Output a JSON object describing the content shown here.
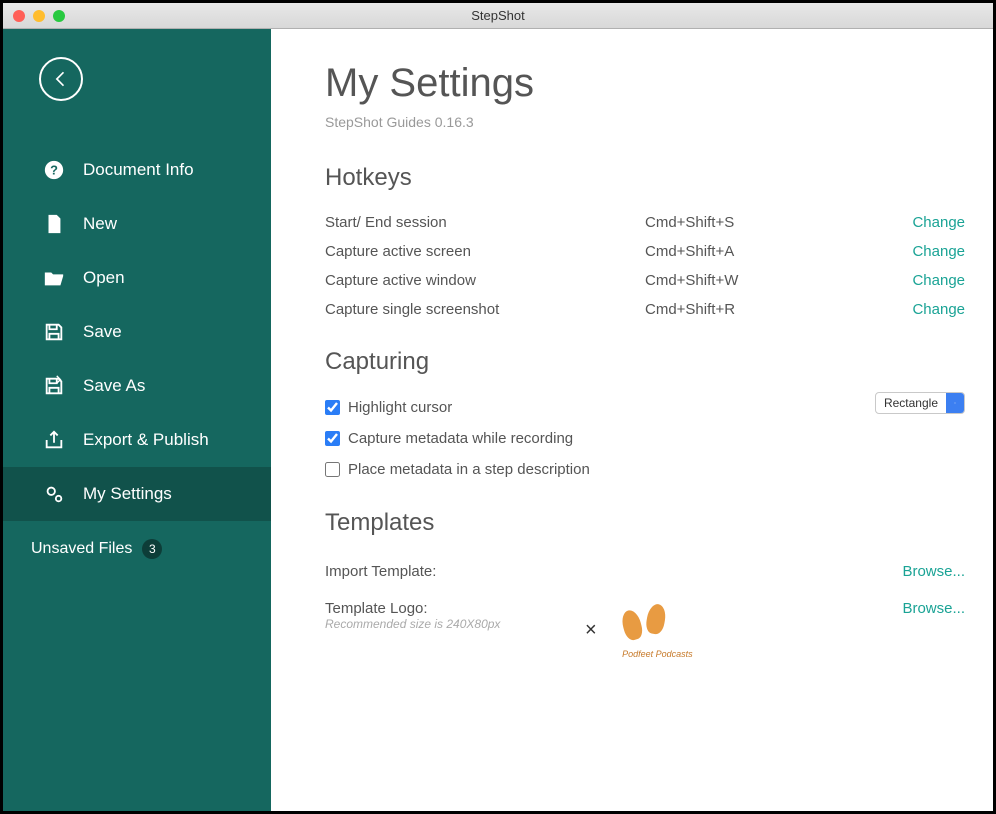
{
  "window": {
    "title": "StepShot"
  },
  "sidebar": {
    "items": [
      {
        "label": "Document Info"
      },
      {
        "label": "New"
      },
      {
        "label": "Open"
      },
      {
        "label": "Save"
      },
      {
        "label": "Save As"
      },
      {
        "label": "Export & Publish"
      },
      {
        "label": "My Settings"
      }
    ],
    "unsaved_label": "Unsaved Files",
    "unsaved_count": "3"
  },
  "page": {
    "title": "My Settings",
    "version": "StepShot Guides 0.16.3"
  },
  "hotkeys": {
    "heading": "Hotkeys",
    "change_label": "Change",
    "rows": [
      {
        "label": "Start/ End session",
        "value": "Cmd+Shift+S"
      },
      {
        "label": "Capture active screen",
        "value": "Cmd+Shift+A"
      },
      {
        "label": "Capture active window",
        "value": "Cmd+Shift+W"
      },
      {
        "label": "Capture single screenshot",
        "value": "Cmd+Shift+R"
      }
    ]
  },
  "capturing": {
    "heading": "Capturing",
    "highlight_label": "Highlight cursor",
    "metadata_label": "Capture metadata while recording",
    "place_label": "Place metadata in a step description",
    "shape_select": "Rectangle"
  },
  "templates": {
    "heading": "Templates",
    "import_label": "Import Template:",
    "logo_label": "Template Logo:",
    "logo_hint": "Recommended size is 240X80px",
    "browse_label": "Browse...",
    "logo_text": "Podfeet\nPodcasts"
  }
}
